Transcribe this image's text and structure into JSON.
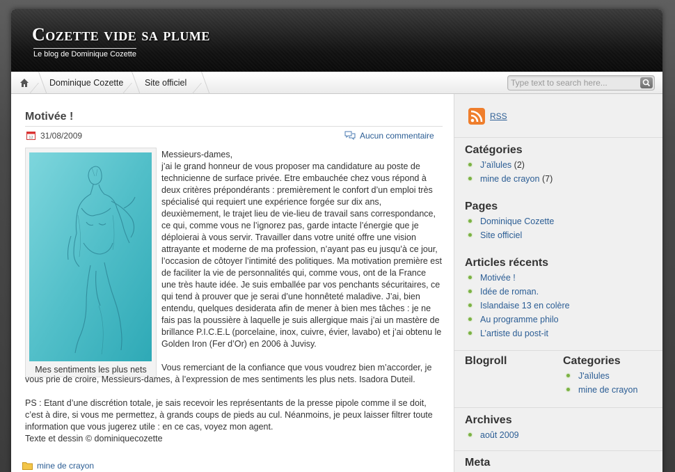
{
  "site": {
    "title": "Cozette vide sa plume",
    "description": "Le blog de Dominique Cozette"
  },
  "nav": {
    "home_icon": "home-icon",
    "items": [
      {
        "label": "Dominique Cozette"
      },
      {
        "label": "Site officiel"
      }
    ],
    "search_placeholder": "Type text to search here...",
    "search_icon": "search-icon"
  },
  "post": {
    "title": "Motivée !",
    "date": "31/08/2009",
    "comments_label": "Aucun commentaire",
    "image_caption": "Mes sentiments les plus nets",
    "intro": "Messieurs-dames,",
    "para1": "j’ai le grand honneur de vous proposer ma candidature au poste de technicienne de surface privée. Etre embauchée chez vous répond à deux critères prépondérants : premièrement le confort d’un emploi très spécialisé qui requiert une expérience forgée sur dix ans, deuxièmement, le trajet lieu de vie-lieu de travail sans correspondance, ce qui, comme vous ne l’ignorez pas, garde intacte l’énergie que je déploierai à vous servir. Travailler dans votre unité offre une vision attrayante et moderne de ma profession, n’ayant pas eu jusqu’à ce jour, l’occasion de côtoyer l’intimité des politiques. Ma motivation première est de faciliter la vie de personnalités qui, comme vous, ont de la France une très haute idée. Je suis emballée par vos penchants sécuritaires, ce qui tend à prouver que je serai d’une honnêteté maladive. J’ai, bien entendu, quelques desiderata afin de mener à bien mes tâches : je ne fais pas la poussière à laquelle je suis allergique mais j’ai un mastère de brillance P.I.C.E.L (porcelaine, inox, cuivre, évier, lavabo) et j’ai obtenu le Golden Iron (Fer d’Or) en 2006 à Juvisy.",
    "para2": "Vous remerciant de la confiance que vous voudrez bien m’accorder, je vous prie de croire, Messieurs-dames, à l’expression de mes sentiments les plus nets. Isadora Duteil.",
    "para3": "PS : Etant d’une discrétion totale, je sais recevoir les représentants de la presse pipole comme il se doit, c’est à dire, si vous me permettez, à grands coups de pieds au cul. Néanmoins, je peux laisser filtrer toute information que vous jugerez utile : en ce cas, voyez mon agent.",
    "credit": "Texte et dessin © dominiquecozette",
    "category": "mine de crayon"
  },
  "sidebar": {
    "rss_label": "RSS",
    "categories": {
      "title": "Catégories",
      "items": [
        {
          "label": "J’aïlules",
          "count": "(2)"
        },
        {
          "label": "mine de crayon",
          "count": "(7)"
        }
      ]
    },
    "pages": {
      "title": "Pages",
      "items": [
        "Dominique Cozette",
        "Site officiel"
      ]
    },
    "recent": {
      "title": "Articles récents",
      "items": [
        "Motivée !",
        "Idée de roman.",
        "Islandaise 13 en colère",
        "Au programme philo",
        "L’artiste du post-it"
      ]
    },
    "blogroll": {
      "title": "Blogroll"
    },
    "categories2": {
      "title": "Categories",
      "items": [
        "J'aïlules",
        "mine de crayon"
      ]
    },
    "archives": {
      "title": "Archives",
      "items": [
        "août 2009"
      ]
    },
    "meta": {
      "title": "Meta"
    }
  },
  "colors": {
    "link": "#2b5d94",
    "bullet": "#7bb144",
    "header": "#111111",
    "drawing_bg": "#5ec2cc"
  }
}
